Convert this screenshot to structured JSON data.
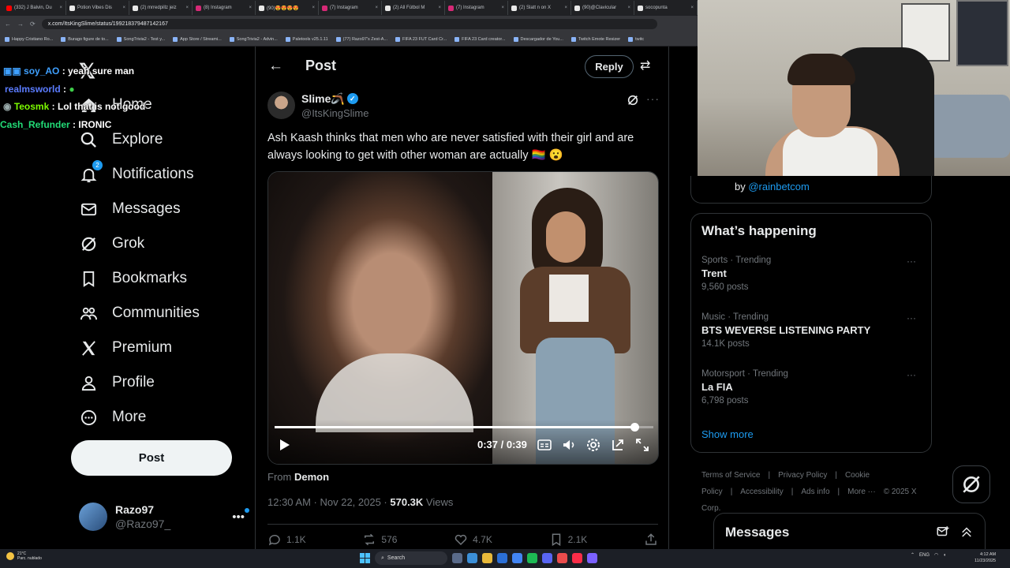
{
  "browser": {
    "tabs": [
      {
        "label": "(332) J Balvin, Du",
        "color": "#ff0000"
      },
      {
        "label": "Potion Vibes Dis",
        "color": "#e8e8e8"
      },
      {
        "label": "(2) mrredpillz jeiz",
        "color": "#e8e8e8"
      },
      {
        "label": "(8) Instagram",
        "color": "#d62976"
      },
      {
        "label": "(90)😍😍😍😍",
        "color": "#e8e8e8"
      },
      {
        "label": "(7) Instagram",
        "color": "#d62976"
      },
      {
        "label": "(2) All Fútbol M",
        "color": "#e8e8e8"
      },
      {
        "label": "(7) Instagram",
        "color": "#d62976"
      },
      {
        "label": "(2) Slatt n on X",
        "color": "#e8e8e8"
      },
      {
        "label": "(90)@Clavicular",
        "color": "#e8e8e8"
      },
      {
        "label": "socopunta",
        "color": "#e8e8e8"
      }
    ],
    "url": "x.com/ItsKingSlime/status/1992183794871421​67",
    "bookmarks": [
      "Happy Cristiano Ro...",
      "Burago figure de to...",
      "SongTrivia2 - Test y...",
      "App Store / Streami...",
      "SongTrivia2 - Advin...",
      "Paletools v25.1.11",
      "(77) Razo97's Zest-A...",
      "FIFA 23 FUT Card Cr...",
      "FIFA 23 Card creator...",
      "Descargador de You...",
      "Twitch Emote Resizer",
      "twitc"
    ]
  },
  "chat": [
    {
      "user": "soy_AO",
      "sep": " : ",
      "msg": "yeah sure man",
      "color": "#3fa0ff"
    },
    {
      "user": "realmsworld",
      "sep": " : ",
      "msg": "",
      "color": "#5b7cff"
    },
    {
      "user": "Teosmk",
      "sep": " : ",
      "msg": "Lol that is not good",
      "color": "#7cfc00"
    },
    {
      "user": "Cash_Refunder",
      "sep": " : ",
      "msg": "IRONIC",
      "color": "#22dd77"
    }
  ],
  "nav": {
    "home": "Home",
    "explore": "Explore",
    "notifications": "Notifications",
    "notifications_badge": "2",
    "messages": "Messages",
    "grok": "Grok",
    "bookmarks": "Bookmarks",
    "communities": "Communities",
    "premium": "Premium",
    "profile": "Profile",
    "more": "More",
    "post_button": "Post"
  },
  "account": {
    "display_name": "Razo97",
    "handle": "@Razo97_"
  },
  "post_header": {
    "title": "Post",
    "reply_button": "Reply"
  },
  "post": {
    "display_name": "Slime🪃",
    "handle": "@ItsKingSlime",
    "text": "Ash Kaash thinks that men who are never satisfied with their girl and are always looking to get with other woman are actually 🏳️‍🌈 😮",
    "video": {
      "current_time": "0:37",
      "duration": "0:39",
      "progress": 0.949
    },
    "from_label": "From",
    "from_source": "Demon",
    "timestamp": "12:30 AM · Nov 22, 2025 · ",
    "views_count": "570.3K",
    "views_label": " Views",
    "replies": "1.1K",
    "reposts": "576",
    "likes": "4.7K",
    "bookmarks": "2.1K"
  },
  "promo": {
    "by_label": "by ",
    "handle": "@rainbetcom"
  },
  "happening": {
    "title": "What’s happening",
    "trends": [
      {
        "context": "Sports · Trending",
        "name": "Trent",
        "count": "9,560 posts"
      },
      {
        "context": "Music · Trending",
        "name": "BTS WEVERSE LISTENING PARTY",
        "count": "14.1K posts"
      },
      {
        "context": "Motorsport · Trending",
        "name": "La FIA",
        "count": "6,798 posts"
      }
    ],
    "show_more": "Show more"
  },
  "footer": {
    "links": [
      "Terms of Service",
      "|",
      "Privacy Policy",
      "|",
      "Cookie Policy",
      "|",
      "Accessibility",
      "|",
      "Ads info",
      "|",
      "More ···",
      "© 2025 X Corp."
    ]
  },
  "messages_drawer": {
    "title": "Messages"
  },
  "taskbar": {
    "weather_temp": "21°C",
    "weather_desc": "Parc. nublado",
    "search": "Search",
    "lang": "ENG",
    "time": "4:12 AM",
    "date": "11/23/2025"
  },
  "colors": {
    "accent": "#1d9bf0",
    "background": "#000000",
    "border": "#2f3336",
    "muted": "#71767b"
  }
}
